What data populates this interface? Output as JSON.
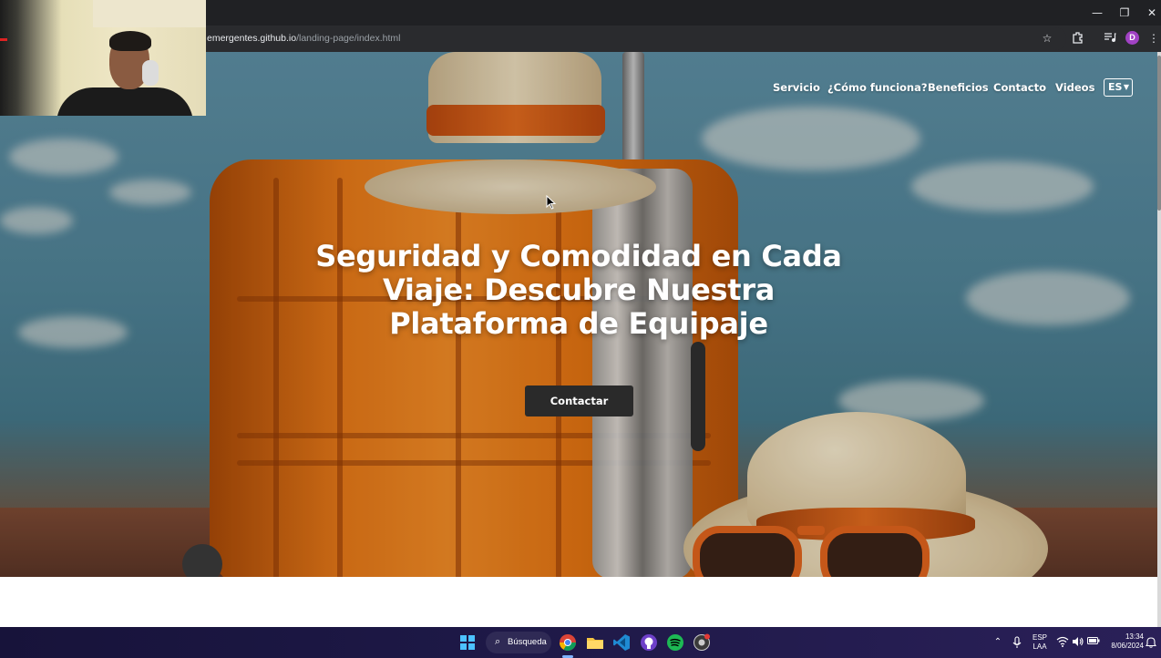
{
  "browser": {
    "url_host": "emergentes.github.io",
    "url_path": "/landing-page/index.html",
    "window_controls": {
      "minimize": "—",
      "restore": "❐",
      "close": "✕"
    },
    "toolbar_icons": [
      "star-icon",
      "extensions-icon",
      "media-icon"
    ],
    "profile_initial": "D"
  },
  "site": {
    "nav": [
      {
        "label": "Servicio"
      },
      {
        "label": "¿Cómo funciona?"
      },
      {
        "label": "Beneficios"
      },
      {
        "label": "Contacto"
      },
      {
        "label": "Videos"
      }
    ],
    "language": "ES",
    "headline": "Seguridad y Comodidad en Cada Viaje: Descubre Nuestra Plataforma de Equipaje",
    "cta_label": "Contactar"
  },
  "taskbar": {
    "search_label": "Búsqueda",
    "apps": [
      "chrome-icon",
      "file-explorer-icon",
      "vscode-icon",
      "github-icon",
      "spotify-icon",
      "chrome-dev-icon"
    ],
    "language_line1": "ESP",
    "language_line2": "LAA",
    "time": "13:34",
    "date": "8/06/2024"
  },
  "colors": {
    "accent_blue": "#4cc2ff",
    "cta_background": "#2a2a2a",
    "profile": "#a142c4"
  }
}
